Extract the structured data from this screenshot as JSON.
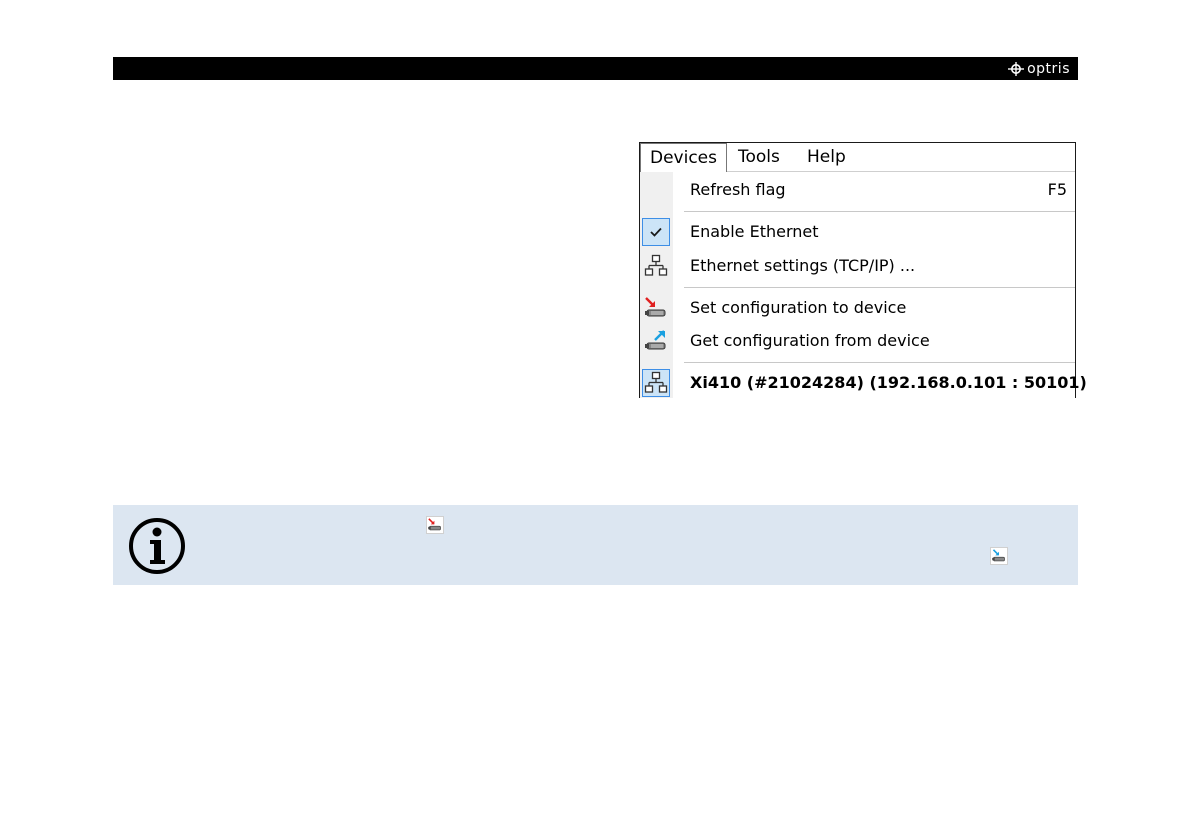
{
  "header": {
    "logo_text": "optris",
    "bar_color": "#000000"
  },
  "menu": {
    "bar_items": [
      {
        "label": "Devices",
        "active": true
      },
      {
        "label": "Tools",
        "active": false
      },
      {
        "label": "Help",
        "active": false
      }
    ],
    "items": [
      {
        "label": "Refresh flag",
        "shortcut": "F5",
        "icon": "none"
      },
      {
        "label": "Enable Ethernet",
        "icon": "checkmark-icon",
        "checked": true
      },
      {
        "label": "Ethernet settings (TCP/IP) ...",
        "icon": "network-icon"
      },
      {
        "label": "Set configuration to device",
        "icon": "set-config-icon"
      },
      {
        "label": "Get configuration from device",
        "icon": "get-config-icon"
      },
      {
        "label": "Xi410  (#21024284)  (192.168.0.101 : 50101)",
        "icon": "network-icon",
        "bold": true
      }
    ]
  },
  "info_box": {
    "background": "#dce6f1",
    "icon": "info-icon"
  }
}
